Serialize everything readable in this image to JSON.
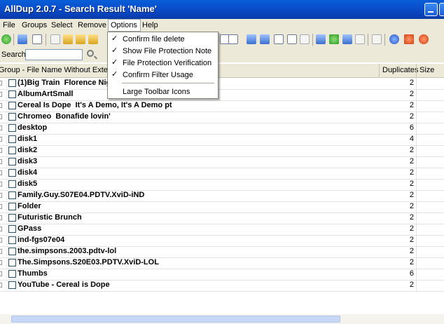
{
  "window": {
    "title": "AllDup 2.0.7 - Search Result 'Name'"
  },
  "menu": [
    {
      "label": "File"
    },
    {
      "label": "Groups"
    },
    {
      "label": "Select"
    },
    {
      "label": "Remove"
    },
    {
      "label": "Options"
    },
    {
      "label": "Help"
    }
  ],
  "options_menu": {
    "items": [
      {
        "label": "Confirm file delete",
        "checked": true,
        "check_glyph": "✓"
      },
      {
        "label": "Show File Protection Note",
        "checked": true,
        "check_glyph": "✓"
      },
      {
        "label": "File Protection Verification",
        "checked": true,
        "check_glyph": "✓"
      },
      {
        "label": "Confirm Filter Usage",
        "checked": true,
        "check_glyph": "✓"
      },
      {
        "label": "Large Toolbar Icons",
        "checked": false
      }
    ]
  },
  "search": {
    "label": "Search:",
    "value": "",
    "icon": "magnifier-icon"
  },
  "columns": {
    "group": "Group - File Name Without Extension",
    "duplicates": "Duplicates",
    "size": "Size"
  },
  "rows": [
    {
      "name": "(1)Big Train  Florence Night",
      "duplicates": "2"
    },
    {
      "name": "AlbumArtSmall",
      "duplicates": "2"
    },
    {
      "name": "Cereal Is Dope  It's A Demo, It's A Demo pt",
      "duplicates": "2"
    },
    {
      "name": "Chromeo  Bonafide lovin'",
      "duplicates": "2"
    },
    {
      "name": "desktop",
      "duplicates": "6"
    },
    {
      "name": "disk1",
      "duplicates": "4"
    },
    {
      "name": "disk2",
      "duplicates": "2"
    },
    {
      "name": "disk3",
      "duplicates": "2"
    },
    {
      "name": "disk4",
      "duplicates": "2"
    },
    {
      "name": "disk5",
      "duplicates": "2"
    },
    {
      "name": "Family.Guy.S07E04.PDTV.XviD-iND",
      "duplicates": "2"
    },
    {
      "name": "Folder",
      "duplicates": "2"
    },
    {
      "name": "Futuristic Brunch",
      "duplicates": "2"
    },
    {
      "name": "GPass",
      "duplicates": "2"
    },
    {
      "name": "ind-fgs07e04",
      "duplicates": "2"
    },
    {
      "name": "the.simpsons.2003.pdtv-lol",
      "duplicates": "2"
    },
    {
      "name": "The.Simpsons.S20E03.PDTV.XviD-LOL",
      "duplicates": "2"
    },
    {
      "name": "Thumbs",
      "duplicates": "6"
    },
    {
      "name": "YouTube - Cereal is Dope",
      "duplicates": "2"
    }
  ]
}
